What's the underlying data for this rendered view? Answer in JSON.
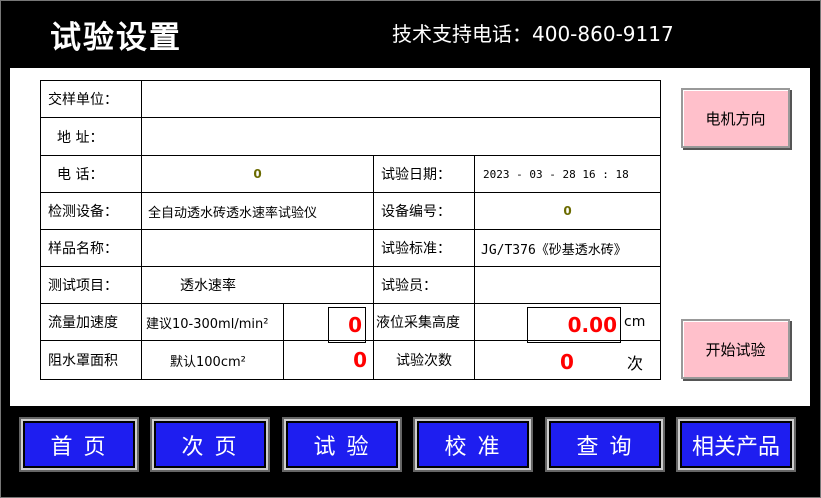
{
  "header": {
    "title": "试验设置",
    "support": "技术支持电话：400-860-9117"
  },
  "form": {
    "sample_unit_label": "交样单位：",
    "sample_unit_value": "",
    "address_label": "地  址：",
    "address_value": "",
    "phone_label": "电  话：",
    "phone_value": "0",
    "test_date_label": "试验日期：",
    "test_date_value": "2023 - 03 - 28    16 :  18",
    "device_label": "检测设备：",
    "device_value": "全自动透水砖透水速率试验仪",
    "device_no_label": "设备编号：",
    "device_no_value": "0",
    "sample_name_label": "样品名称：",
    "sample_name_value": "",
    "standard_label": "试验标准：",
    "standard_value": "JG/T376《砂基透水砖》",
    "item_label": "测试项目：",
    "item_value": "透水速率",
    "tester_label": "试验员：",
    "tester_value": "",
    "flow_accel_label": "流量加速度",
    "flow_accel_hint": "建议10-300ml/min²",
    "flow_accel_value": "0",
    "level_height_label": "液位采集高度",
    "level_height_value": "0.00",
    "level_height_unit": "cm",
    "cover_area_label": "阻水罩面积",
    "cover_area_hint": "默认100cm²",
    "cover_area_value": "0",
    "test_count_label": "试验次数",
    "test_count_value": "0",
    "test_count_unit": "次"
  },
  "side_buttons": {
    "motor_direction": "电机方向",
    "start_test": "开始试验"
  },
  "nav": {
    "home": "首  页",
    "next": "次  页",
    "test": "试 验",
    "calibrate": "校 准",
    "query": "查 询",
    "products": "相关产品"
  },
  "colors": {
    "nav_blue": "#1e1ef0",
    "button_pink": "#ffc0cb",
    "value_red": "#ff0000"
  }
}
